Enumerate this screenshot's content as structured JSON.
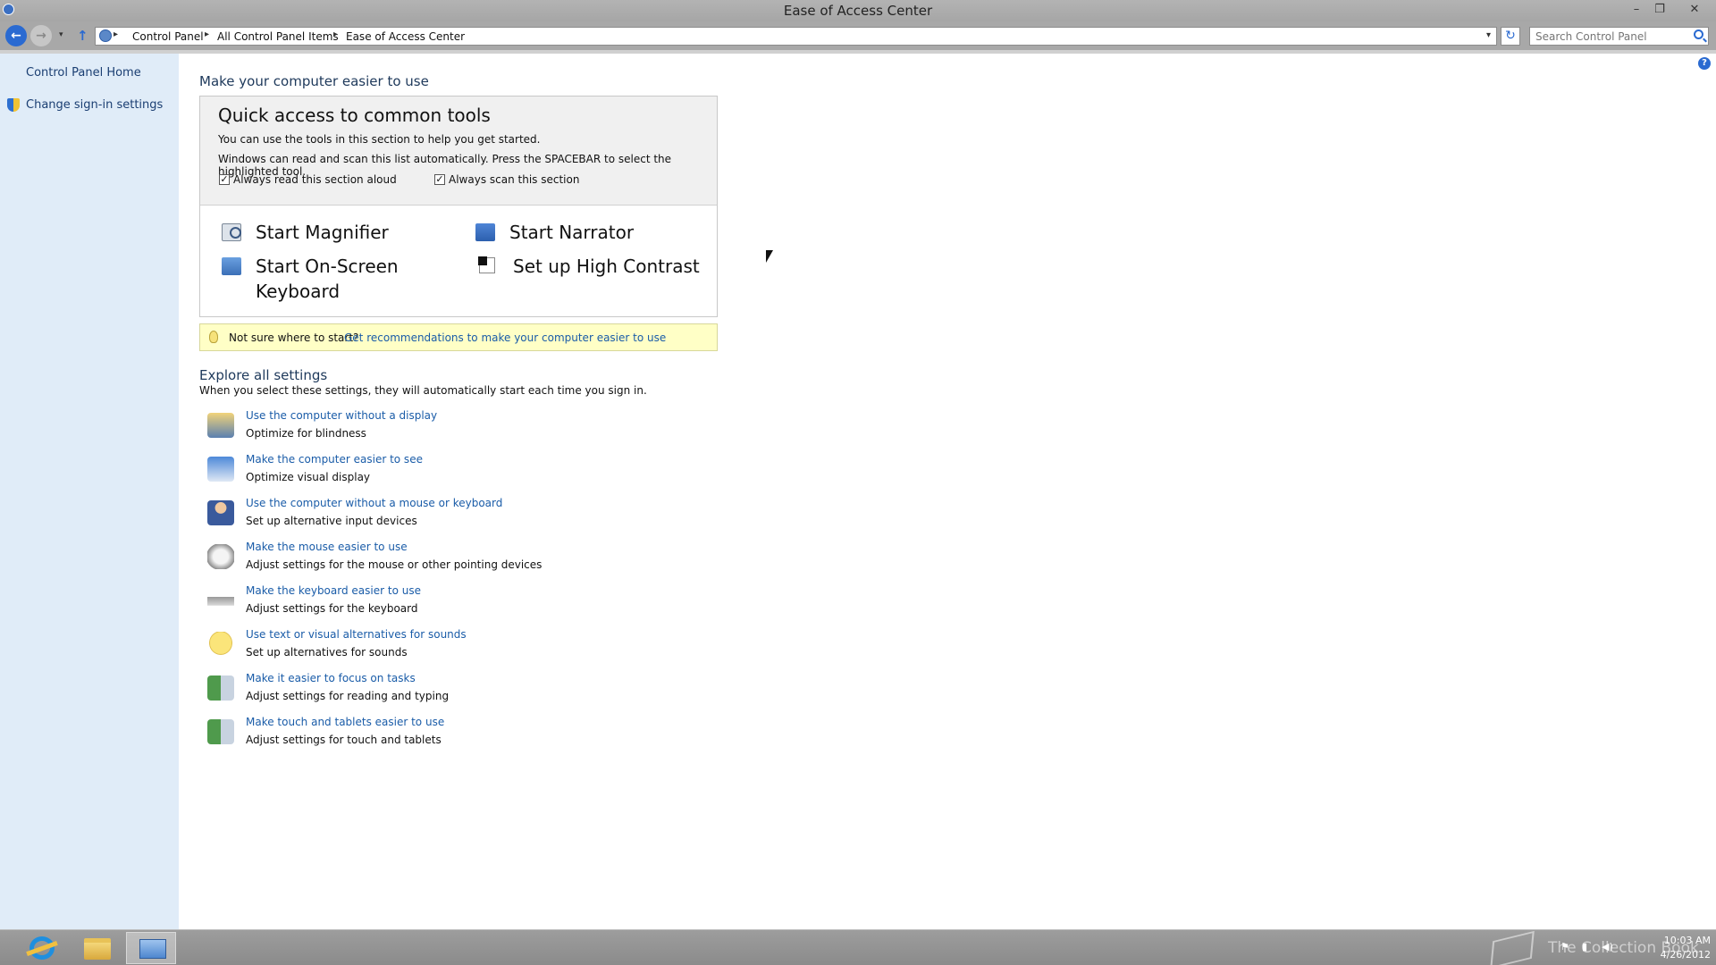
{
  "window": {
    "title": "Ease of Access Center",
    "minimize": "–",
    "maximize": "❐",
    "close": "✕"
  },
  "address_bar": {
    "back": "←",
    "forward": "→",
    "history": "▾",
    "up": "↑",
    "separator": "▸",
    "breadcrumbs": [
      "Control Panel",
      "All Control Panel Items",
      "Ease of Access Center"
    ],
    "dropdown": "▾",
    "refresh": "↻",
    "search_placeholder": "Search Control Panel"
  },
  "sidebar": {
    "home": "Control Panel Home",
    "signin": "Change sign-in settings"
  },
  "help": "?",
  "main": {
    "title": "Make your computer easier to use",
    "quick_access": {
      "title": "Quick access to common tools",
      "line1": "You can use the tools in this section to help you get started.",
      "line2": "Windows can read and scan this list automatically.  Press the SPACEBAR to select the highlighted tool.",
      "check_mark": "✓",
      "checkbox_read": {
        "label": "Always read this section aloud",
        "checked": true
      },
      "checkbox_scan": {
        "label": "Always scan this section",
        "checked": true
      },
      "tools": {
        "magnifier": "Start Magnifier",
        "narrator": "Start Narrator",
        "keyboard": "Start On-Screen Keyboard",
        "contrast": "Set up High Contrast"
      }
    },
    "tip": {
      "question": "Not sure where to start?",
      "link": "Get recommendations to make your computer easier to use"
    },
    "explore": {
      "title": "Explore all settings",
      "description": "When you select these settings, they will automatically start each time you sign in.",
      "items": [
        {
          "link": "Use the computer without a display",
          "desc": "Optimize for blindness"
        },
        {
          "link": "Make the computer easier to see",
          "desc": "Optimize visual display"
        },
        {
          "link": "Use the computer without a mouse or keyboard",
          "desc": "Set up alternative input devices"
        },
        {
          "link": "Make the mouse easier to use",
          "desc": "Adjust settings for the mouse or other pointing devices"
        },
        {
          "link": "Make the keyboard easier to use",
          "desc": "Adjust settings for the keyboard"
        },
        {
          "link": "Use text or visual alternatives for sounds",
          "desc": "Set up alternatives for sounds"
        },
        {
          "link": "Make it easier to focus on tasks",
          "desc": "Adjust settings for reading and typing"
        },
        {
          "link": "Make touch and tablets easier to use",
          "desc": "Adjust settings for touch and tablets"
        }
      ]
    }
  },
  "taskbar": {
    "watermark": "The Collection Book",
    "tray": {
      "flag": "⚑",
      "network": "▮",
      "volume": "◀)"
    },
    "time": "10:03 AM",
    "date": "4/26/2012"
  },
  "colors": {
    "link": "#1a5ca8",
    "heading": "#1e395b",
    "sidebar_bg": "#e0ecf8",
    "tip_bg": "#ffffc6",
    "taskbar_bg": "#949494"
  }
}
